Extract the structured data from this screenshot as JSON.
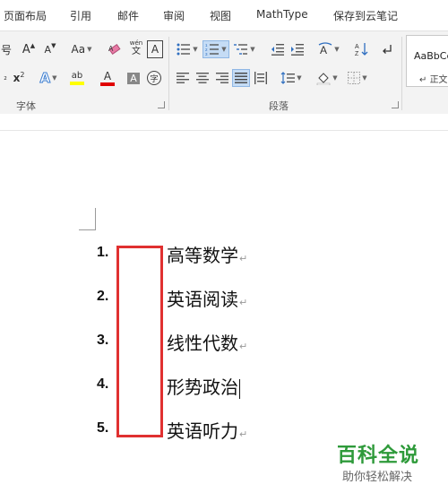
{
  "menu": {
    "tabs": [
      "页面布局",
      "引用",
      "邮件",
      "审阅",
      "视图",
      "MathType",
      "保存到云笔记"
    ]
  },
  "ribbon": {
    "font_group": {
      "label": "字体",
      "buttons": {
        "grow": "A",
        "shrink": "A",
        "change_case": "Aa",
        "phonetic_top": "wén",
        "phonetic_bottom": "文",
        "border": "A",
        "subscript": "x",
        "superscript_mark": "2",
        "text_effect": "A",
        "highlight": "ab",
        "font_color": "A",
        "shade": "A",
        "enclose": "字",
        "size_fragment": "号"
      }
    },
    "paragraph_group": {
      "label": "段落"
    },
    "styles": {
      "sample": "AaBbCc",
      "name": "正文"
    },
    "colors": {
      "highlight": "#ffff00",
      "font_color": "#e00000",
      "active_bg": "#c5dcf5"
    }
  },
  "document": {
    "list": [
      {
        "number": "1.",
        "text": "高等数学"
      },
      {
        "number": "2.",
        "text": "英语阅读"
      },
      {
        "number": "3.",
        "text": "线性代数"
      },
      {
        "number": "4.",
        "text": "形势政治"
      },
      {
        "number": "5.",
        "text": "英语听力"
      }
    ],
    "paragraph_mark": "↵",
    "highlight_color": "#e03030"
  },
  "watermark": {
    "title": "百科全说",
    "subtitle": "助你轻松解决"
  }
}
